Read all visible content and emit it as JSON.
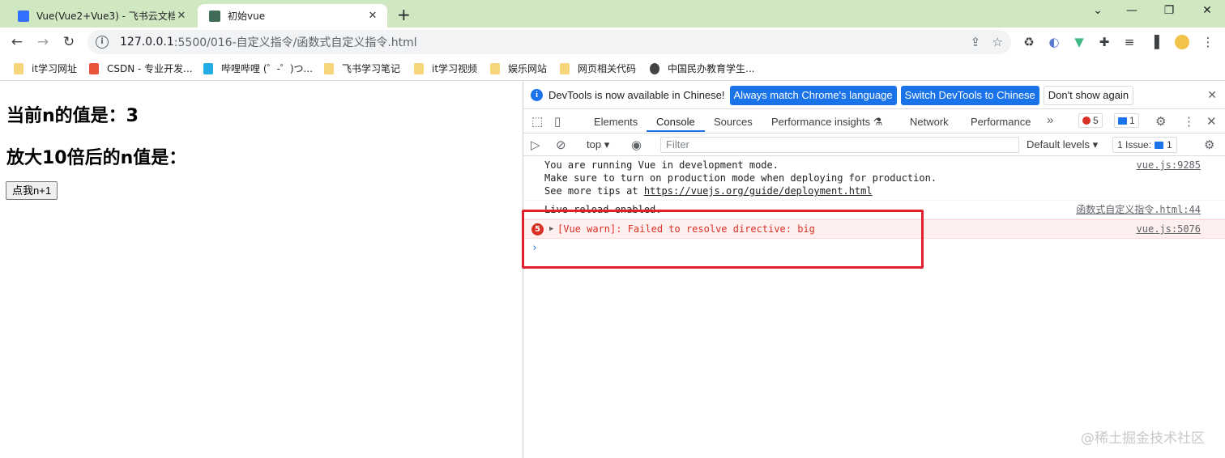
{
  "browser": {
    "tabs": [
      {
        "title": "Vue(Vue2+Vue3) - 飞书云文档",
        "active": false,
        "favicon": "doc-icon",
        "color": "#3370ff"
      },
      {
        "title": "初始vue",
        "active": true,
        "favicon": "vue-icon",
        "color": "#3f6b57"
      }
    ],
    "url": {
      "host": "127.0.0.1",
      "path": ":5500/016-自定义指令/函数式自定义指令.html"
    },
    "bookmarks": [
      {
        "label": "it学习网址",
        "icon": "folder-icon"
      },
      {
        "label": "CSDN - 专业开发...",
        "icon": "csdn-icon"
      },
      {
        "label": "哔哩哔哩 (゜-゜)つ...",
        "icon": "bilibili-icon"
      },
      {
        "label": "飞书学习笔记",
        "icon": "folder-icon"
      },
      {
        "label": "it学习视频",
        "icon": "folder-icon"
      },
      {
        "label": "娱乐网站",
        "icon": "folder-icon"
      },
      {
        "label": "网页相关代码",
        "icon": "folder-icon"
      },
      {
        "label": "中国民办教育学生...",
        "icon": "globe-icon"
      }
    ]
  },
  "page": {
    "heading_n": "当前n的值是：3",
    "heading_big": "放大10倍后的n值是：",
    "button_label": "点我n+1"
  },
  "devtools": {
    "infobar": {
      "text": "DevTools is now available in Chinese!",
      "btn_match": "Always match Chrome's language",
      "btn_switch": "Switch DevTools to Chinese",
      "btn_dismiss": "Don't show again"
    },
    "tabs": [
      "Elements",
      "Console",
      "Sources",
      "Performance insights",
      "Network",
      "Performance"
    ],
    "selected_tab": "Console",
    "error_count": "5",
    "message_count": "1",
    "toolbar": {
      "context": "top",
      "filter_placeholder": "Filter",
      "levels": "Default levels",
      "issues_label": "1 Issue:",
      "issues_count": "1"
    },
    "console": {
      "vue_dev_line1": "You are running Vue in development mode.",
      "vue_dev_line2": "Make sure to turn on production mode when deploying for production.",
      "vue_dev_line3_prefix": "See more tips at ",
      "vue_dev_link": "https://vuejs.org/guide/deployment.html",
      "vue_dev_src": "vue.js:9285",
      "live_reload": "Live reload enabled.",
      "live_reload_src": "函数式自定义指令.html:44",
      "warn_count": "5",
      "warn_text": "[Vue warn]: Failed to resolve directive: big",
      "warn_src": "vue.js:5076",
      "prompt": "›"
    }
  },
  "watermark": "@稀土掘金技术社区"
}
